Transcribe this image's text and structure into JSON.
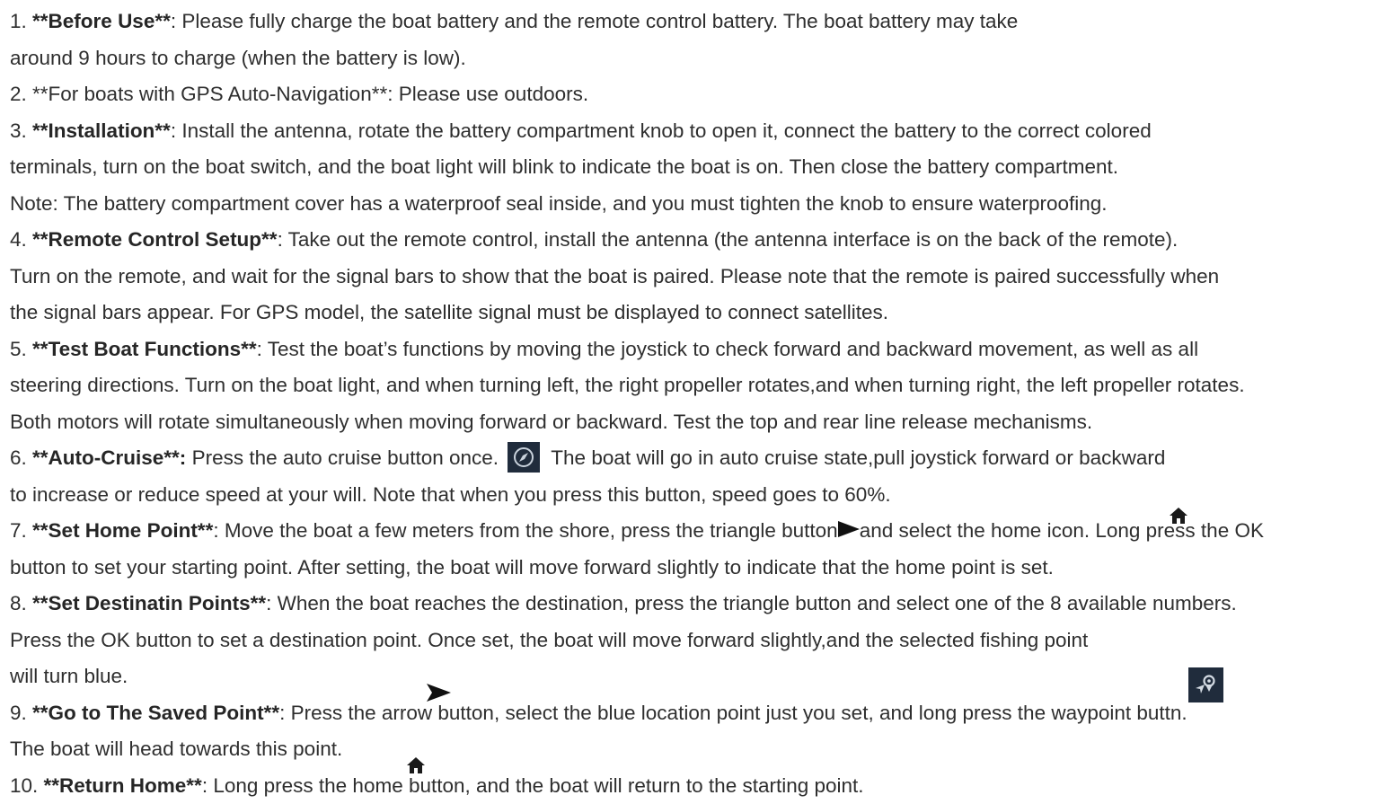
{
  "lines": [
    {
      "pre": "1. ",
      "bold": "**Before Use**",
      "post": ": Please fully charge the boat battery and the remote control battery. The boat battery may take"
    },
    {
      "text": "around 9 hours to charge (when the battery is low)."
    },
    {
      "text": "2. **For boats with GPS Auto-Navigation**: Please use outdoors."
    },
    {
      "pre": "3. ",
      "bold": "**Installation**",
      "post": ": Install the antenna, rotate the battery compartment knob to open it, connect the battery to the correct colored"
    },
    {
      "text": "terminals, turn on the boat switch, and the boat light will blink to indicate the boat is on. Then close the battery compartment."
    },
    {
      "text": "Note: The battery compartment cover has a waterproof seal inside, and you must tighten the knob to ensure waterproofing."
    },
    {
      "pre": "4. ",
      "bold": "**Remote Control Setup**",
      "post": ": Take out the remote control, install the antenna (the antenna interface is on the back of the remote)."
    },
    {
      "text": "Turn on the remote, and wait for the signal bars to show that the boat is paired. Please note that the remote is paired successfully when"
    },
    {
      "text": "the signal bars appear. For GPS model, the satellite signal must be displayed to connect satellites."
    },
    {
      "pre": "5. ",
      "bold": "**Test Boat Functions**",
      "post": ": Test the boat’s functions by moving the joystick to check forward and backward movement, as well as all"
    },
    {
      "text": "steering directions. Turn on the boat light, and when turning left, the right propeller rotates,and when turning right, the left propeller rotates."
    },
    {
      "text": "Both motors will rotate simultaneously when moving forward or backward. Test the top and rear line release mechanisms."
    },
    {
      "pre": "6. ",
      "bold": "**Auto-Cruise**:",
      "post": " Press the auto cruise button once.",
      "post2": "The boat will go in auto cruise state,pull joystick forward or backward"
    },
    {
      "text": "to increase or reduce speed at your will. Note that when you press this button, speed goes to 60%."
    },
    {
      "pre": "7. ",
      "bold": "**Set Home Point**",
      "post": ": Move the boat a few meters from the shore, press the triangle button",
      "post2": "and select the home icon. Long press the OK"
    },
    {
      "text": "button to set your starting point. After setting, the boat will move forward slightly to indicate that the home point is set."
    },
    {
      "pre": "8. ",
      "bold": "**Set Destinatin Points**",
      "post": ": When the boat reaches the destination, press the triangle button and select one of the 8 available numbers."
    },
    {
      "text": "Press the OK button to set a destination point. Once set, the boat will move forward slightly,and the selected fishing point"
    },
    {
      "text": "will turn blue."
    },
    {
      "pre": "9. ",
      "bold": "**Go to The Saved Point**",
      "post": ": Press the arrow button, select the blue location point just you set, and long press the waypoint buttn."
    },
    {
      "text": "The boat will head towards this point."
    },
    {
      "pre": "10. ",
      "bold": "**Return Home**",
      "post": ": Long press the home button, and the boat will return to the starting point."
    }
  ],
  "icons": {
    "auto_cruise": "compass-icon",
    "triangle": "triangle-arrow-icon",
    "home": "home-icon",
    "waypoint": "waypoint-icon",
    "arrow": "arrow-icon",
    "icon_bg": "#202c3c",
    "text_color": "#2e2e2e"
  }
}
